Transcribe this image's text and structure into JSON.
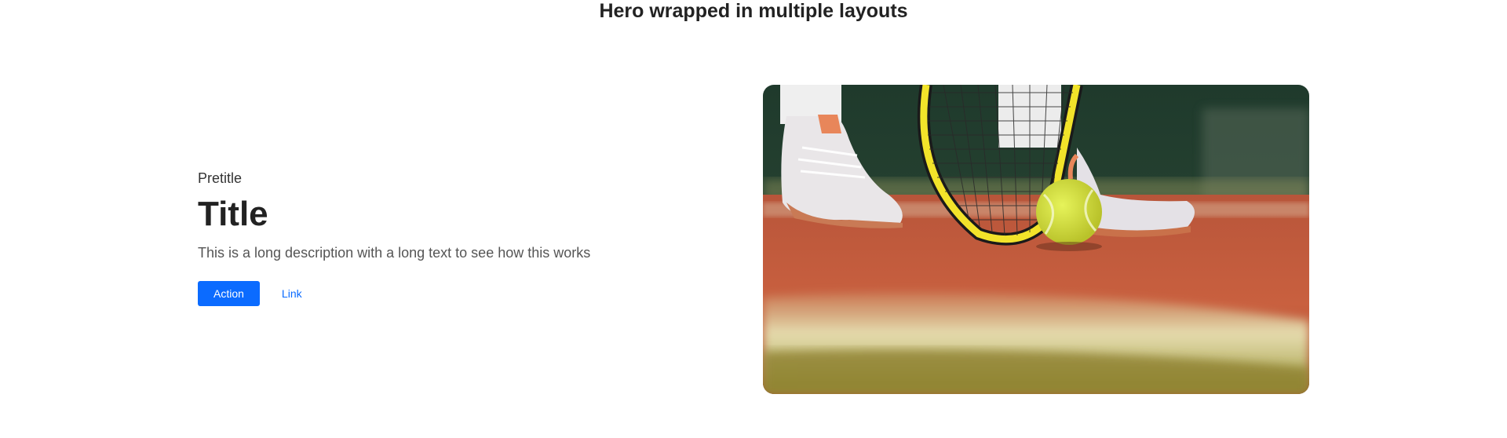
{
  "story": {
    "heading": "Hero wrapped in multiple layouts"
  },
  "hero": {
    "pretitle": "Pretitle",
    "title": "Title",
    "description": "This is a long description with a long text to see how this works",
    "action_label": "Action",
    "link_label": "Link",
    "image": {
      "subject": "tennis player's sneakers, racket and ball on clay court"
    }
  },
  "colors": {
    "accent": "#0b6bff",
    "title": "#222222",
    "description": "#555555"
  }
}
